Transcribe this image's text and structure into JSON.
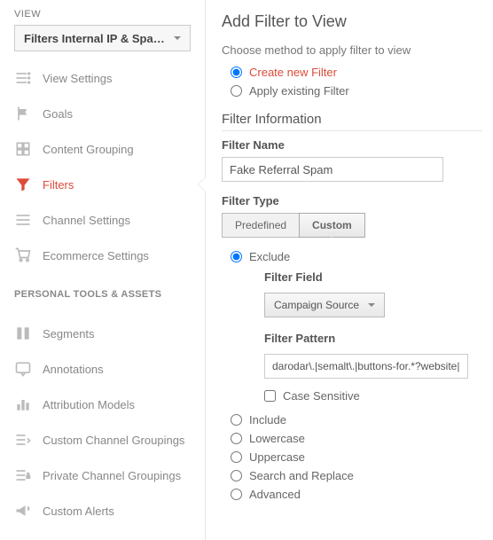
{
  "sidebar": {
    "view_label": "VIEW",
    "view_selected": "Filters Internal IP & Spam...",
    "items": [
      {
        "label": "View Settings"
      },
      {
        "label": "Goals"
      },
      {
        "label": "Content Grouping"
      },
      {
        "label": "Filters"
      },
      {
        "label": "Channel Settings"
      },
      {
        "label": "Ecommerce Settings"
      }
    ],
    "section2_label": "PERSONAL TOOLS & ASSETS",
    "items2": [
      {
        "label": "Segments"
      },
      {
        "label": "Annotations"
      },
      {
        "label": "Attribution Models"
      },
      {
        "label": "Custom Channel Groupings"
      },
      {
        "label": "Private Channel Groupings"
      },
      {
        "label": "Custom Alerts"
      }
    ]
  },
  "main": {
    "title": "Add Filter to View",
    "method_label": "Choose method to apply filter to view",
    "method_options": {
      "create": "Create new Filter",
      "apply": "Apply existing Filter"
    },
    "info_heading": "Filter Information",
    "name_label": "Filter Name",
    "name_value": "Fake Referral Spam",
    "type_label": "Filter Type",
    "type_tabs": {
      "predef": "Predefined",
      "custom": "Custom"
    },
    "exclude_label": "Exclude",
    "field_label": "Filter Field",
    "field_value": "Campaign Source",
    "pattern_label": "Filter Pattern",
    "pattern_value": "darodar\\.|semalt\\.|buttons-for.*?website|blackhatworth",
    "case_label": "Case Sensitive",
    "radios": [
      "Include",
      "Lowercase",
      "Uppercase",
      "Search and Replace",
      "Advanced"
    ]
  }
}
